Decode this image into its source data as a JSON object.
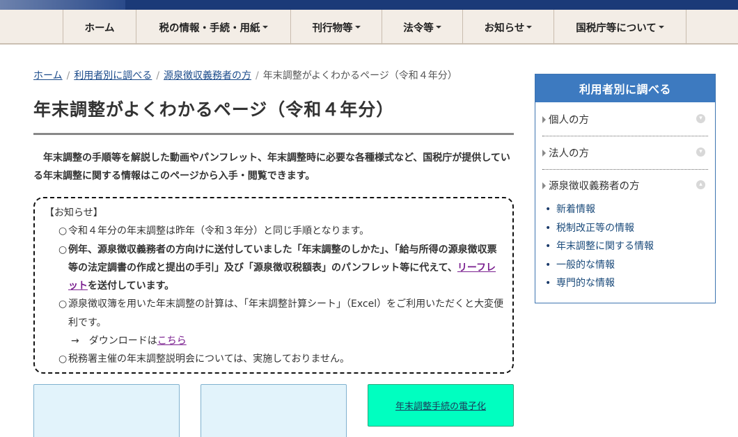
{
  "nav": {
    "items": [
      {
        "label": "ホーム",
        "has_caret": false
      },
      {
        "label": "税の情報・手続・用紙",
        "has_caret": true
      },
      {
        "label": "刊行物等",
        "has_caret": true
      },
      {
        "label": "法令等",
        "has_caret": true
      },
      {
        "label": "お知らせ",
        "has_caret": true
      },
      {
        "label": "国税庁等について",
        "has_caret": true
      }
    ]
  },
  "breadcrumb": {
    "home": "ホーム",
    "by_user": "利用者別に調べる",
    "withholding": "源泉徴収義務者の方",
    "current": "年末調整がよくわかるページ（令和４年分）"
  },
  "page": {
    "title": "年末調整がよくわかるページ（令和４年分）",
    "intro": "年末調整の手順等を解説した動画やパンフレット、年末調整時に必要な各種様式など、国税庁が提供している年末調整に関する情報はこのページから入手・閲覧できます。"
  },
  "notice": {
    "heading": "【お知らせ】",
    "mark": "○",
    "item1": "令和４年分の年末調整は昨年（令和３年分）と同じ手順となります。",
    "item2_a": "例年、源泉徴収義務者の方向けに送付していました「年末調整のしかた」、「給与所得の源泉徴収票等の法定調書の作成と提出の手引」及び「源泉徴収税額表」のパンフレット等に代えて、",
    "item2_link": "リーフレット",
    "item2_b": "を送付しています。",
    "item3": "源泉徴収簿を用いた年末調整の計算は、「年末調整計算シート」（Excel）をご利用いただくと大変便利です。",
    "arrow": "→",
    "download_prefix": "ダウンロードは",
    "download_link": "こちら",
    "item4": "税務署主催の年末調整説明会については、実施しておりません。"
  },
  "cards": {
    "green_label": "年末調整手続の電子化"
  },
  "sidebar": {
    "title": "利用者別に調べる",
    "rows": [
      {
        "label": "個人の方",
        "state": "collapsed"
      },
      {
        "label": "法人の方",
        "state": "collapsed"
      },
      {
        "label": "源泉徴収義務者の方",
        "state": "expanded"
      }
    ],
    "sublinks": [
      "新着情報",
      "税制改正等の情報",
      "年末調整に関する情報",
      "一般的な情報",
      "専門的な情報"
    ]
  },
  "colors": {
    "top_band": "#1b3a78",
    "nav_bg": "#f3ede6",
    "sidebar_head": "#3d7ac0",
    "card_light": "#e2f3fb",
    "card_green": "#00ffc0",
    "link_visited": "#7a1f8f"
  },
  "icons": {
    "nav_dropdown": "caret-down-icon",
    "side_collapsed": "circle-down-icon",
    "side_expanded": "circle-up-icon"
  }
}
